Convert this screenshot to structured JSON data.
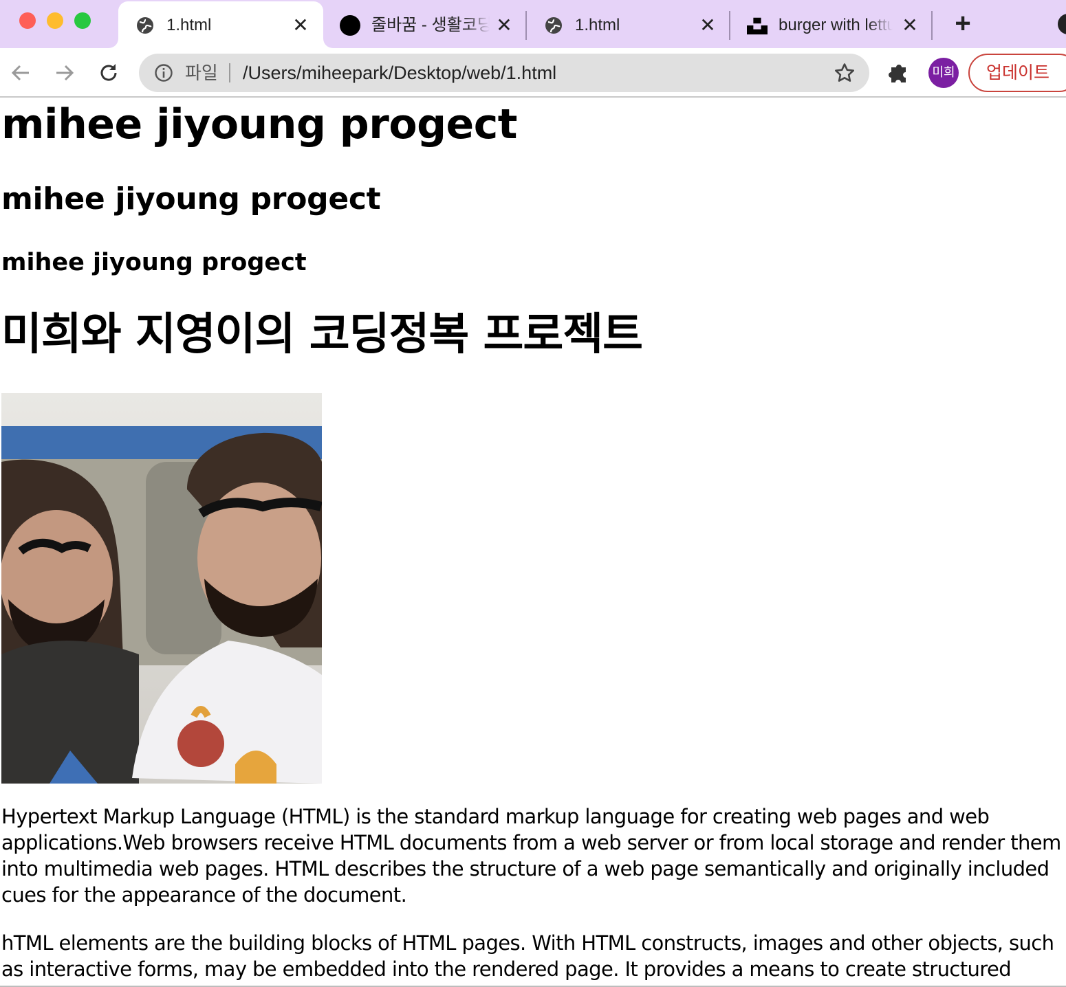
{
  "browser": {
    "tabs": [
      {
        "title": "1.html",
        "favicon": "globe-icon",
        "active": true
      },
      {
        "title": "줄바꿈 - 생활코딩",
        "favicon": "black-circle-icon",
        "active": false
      },
      {
        "title": "1.html",
        "favicon": "globe-icon",
        "active": false
      },
      {
        "title": "burger with lettuce",
        "favicon": "unsplash-icon",
        "active": false
      }
    ],
    "close_glyph": "✕",
    "new_tab_glyph": "+",
    "address_bar": {
      "scheme_label": "파일",
      "url": "/Users/miheepark/Desktop/web/1.html"
    },
    "profile_initials": "미희",
    "update_label": "업데이트",
    "colors": {
      "tabstrip_bg": "#e6d3f8",
      "profile_avatar": "#7b1fa2",
      "update_accent": "#c9302c"
    }
  },
  "page": {
    "heading1": "mihee jiyoung progect",
    "heading2": "mihee jiyoung progect",
    "heading3": "mihee jiyoung progect",
    "heading_korean": "미희와 지영이의 코딩정복 프로젝트",
    "paragraph1": "Hypertext Markup Language (HTML) is the standard markup language for creating web pages and web applications.Web browsers receive HTML documents from a web server or from local storage and render them into multimedia web pages. HTML describes the structure of a web page semantically and originally included cues for the appearance of the document.",
    "paragraph2": "hTML elements are the building blocks of HTML pages. With HTML constructs, images and other objects, such as interactive forms, may be embedded into the rendered page. It provides a means to create structured documents"
  }
}
